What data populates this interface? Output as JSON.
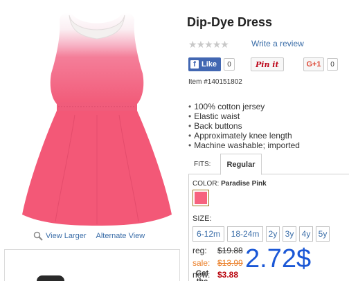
{
  "product": {
    "title": "Dip-Dye Dress",
    "write_review": "Write a review",
    "item_number": "Item #140151802",
    "features": [
      "100% cotton jersey",
      "Elastic waist",
      "Back buttons",
      "Approximately knee length",
      "Machine washable; imported"
    ]
  },
  "social": {
    "facebook_label": "Like",
    "facebook_count": "0",
    "pinterest_label": "Pin it",
    "gplus_label": "G+1",
    "gplus_count": "0"
  },
  "rating": {
    "stars": 0,
    "max": 5,
    "icon": "star-icon"
  },
  "image_links": {
    "view_larger": "View Larger",
    "alternate_view": "Alternate View"
  },
  "get_the_look": "Get the Look!",
  "fits": {
    "label": "FITS:",
    "selected": "Regular"
  },
  "color": {
    "label": "COLOR:",
    "selected": "Paradise Pink",
    "swatch_hex": "#f7637e"
  },
  "size": {
    "label": "SIZE:",
    "options": [
      "6-12m",
      "18-24m",
      "2y",
      "3y",
      "4y",
      "5y"
    ]
  },
  "price": {
    "reg_label": "reg:",
    "reg_value": "$19.88",
    "sale_label": "sale:",
    "sale_value": "$13.99",
    "now_label": "now:",
    "now_value": "$3.88",
    "overlay_price": "2.72$"
  },
  "colors": {
    "link": "#3a6da8",
    "sale": "#ea7b21",
    "now": "#b8000a",
    "overlay": "#1a57d6",
    "dress_pink": "#f25d7a"
  }
}
